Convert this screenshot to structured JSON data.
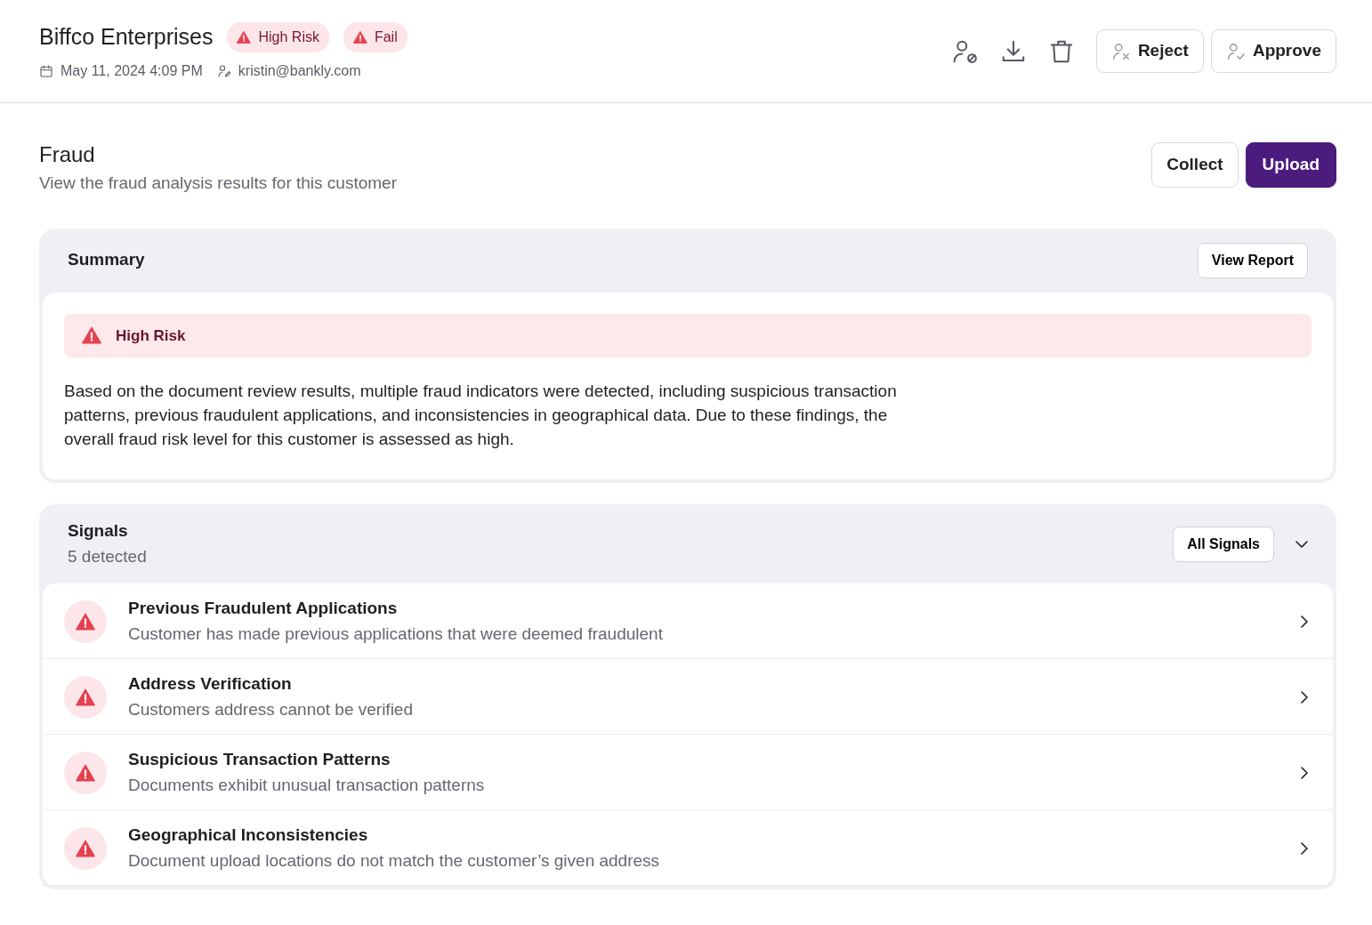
{
  "header": {
    "title": "Biffco Enterprises",
    "badges": [
      {
        "label": "High Risk"
      },
      {
        "label": "Fail"
      }
    ],
    "date": "May 11, 2024 4:09 PM",
    "email": "kristin@bankly.com",
    "actions": [
      {
        "label": "Reject",
        "kind": "reject"
      },
      {
        "label": "Approve",
        "kind": "approve"
      }
    ]
  },
  "section": {
    "title": "Fraud",
    "subtitle": "View the fraud analysis results for this customer",
    "buttons": [
      {
        "label": "Collect",
        "kind": "secondary"
      },
      {
        "label": "Upload",
        "kind": "primary"
      }
    ]
  },
  "summary": {
    "title": "Summary",
    "button": "View Report",
    "alert": "High Risk",
    "text": "Based on the document review results, multiple fraud indicators were detected, including suspicious transaction patterns, previous fraudulent applications, and inconsistencies in geographical data. Due to these findings, the overall fraud risk level for this customer is assessed as high."
  },
  "signals": {
    "title": "Signals",
    "count": "5 detected",
    "filter": "All Signals",
    "items": [
      {
        "title": "Previous Fraudulent Applications",
        "description": "Customer has made previous applications that were deemed fraudulent"
      },
      {
        "title": "Address Verification",
        "description": "Customers address cannot be verified"
      },
      {
        "title": "Suspicious Transaction Patterns",
        "description": "Documents exhibit unusual transaction patterns"
      },
      {
        "title": "Geographical Inconsistencies",
        "description": "Document upload locations do not match the customer’s given address"
      }
    ]
  }
}
